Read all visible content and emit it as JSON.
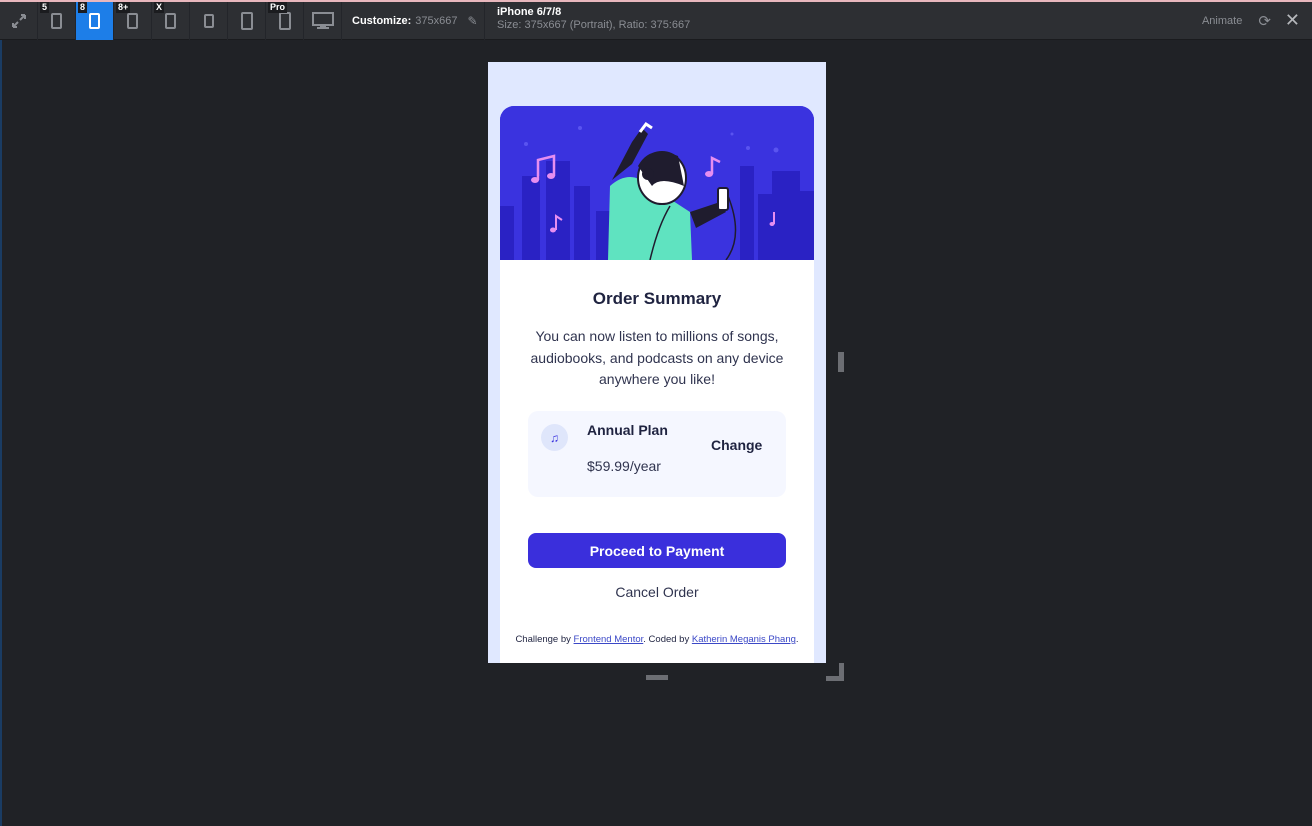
{
  "toolbar": {
    "devices": [
      {
        "badge": "5",
        "icon": "phone-icon"
      },
      {
        "badge": "8",
        "icon": "phone-icon",
        "active": true
      },
      {
        "badge": "8+",
        "icon": "phone-icon"
      },
      {
        "badge": "X",
        "icon": "phone-icon"
      },
      {
        "badge": "",
        "icon": "tablet-icon"
      },
      {
        "badge": "",
        "icon": "tablet-icon"
      },
      {
        "badge": "Pro",
        "icon": "tablet-icon"
      }
    ],
    "customize_label": "Customize:",
    "customize_size": "375x667",
    "device_name": "iPhone 6/7/8",
    "device_size": "Size: 375x667 (Portrait), Ratio: 375:667",
    "animate_label": "Animate"
  },
  "page": {
    "title": "Order Summary",
    "description": "You can now listen to millions of songs, audiobooks, and podcasts on any device anywhere you like!",
    "plan_name": "Annual Plan",
    "plan_price": "$59.99/year",
    "change_label": "Change",
    "pay_label": "Proceed to Payment",
    "cancel_label": "Cancel Order",
    "footer": {
      "prefix": "Challenge by ",
      "link1": "Frontend Mentor",
      "middle": ". Coded by ",
      "link2": "Katherin Meganis Phang",
      "suffix": "."
    }
  },
  "colors": {
    "accent": "#3a2fdc",
    "hero_bg": "#3a33df",
    "viewport_bg": "#e0e8ff",
    "toolbar_bg": "#2d2f33",
    "active_device": "#1d7ee8"
  }
}
